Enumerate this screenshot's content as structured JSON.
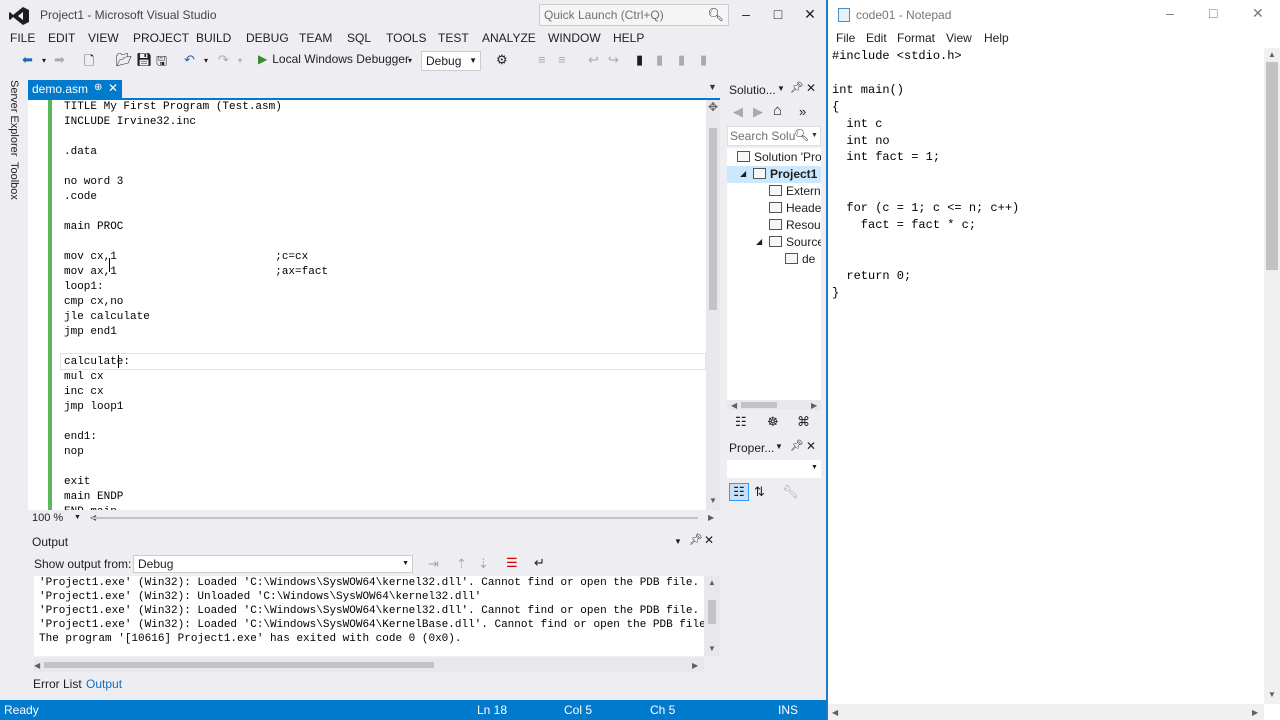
{
  "vs": {
    "title": "Project1 - Microsoft Visual Studio",
    "quick_launch_placeholder": "Quick Launch (Ctrl+Q)",
    "menu": [
      "FILE",
      "EDIT",
      "VIEW",
      "PROJECT",
      "BUILD",
      "DEBUG",
      "TEAM",
      "SQL",
      "TOOLS",
      "TEST",
      "ANALYZE",
      "WINDOW",
      "HELP"
    ],
    "toolbar": {
      "debugger_label": "Local Windows Debugger",
      "config": "Debug"
    },
    "side_tabs": [
      "Server Explorer",
      "Toolbox"
    ],
    "doc_tab": "demo.asm",
    "code_lines": [
      "TITLE My First Program (Test.asm)",
      "INCLUDE Irvine32.inc",
      "",
      ".data",
      "",
      "no word 3",
      ".code",
      "",
      "main PROC",
      "",
      "mov cx,1                        ;c=cx",
      "mov ax,1                        ;ax=fact",
      "loop1:",
      "cmp cx,no",
      "jle calculate",
      "jmp end1",
      "",
      "calculate:",
      "mul cx",
      "inc cx",
      "jmp loop1",
      "",
      "end1:",
      "nop",
      "",
      "exit",
      "main ENDP",
      "END main"
    ],
    "zoom": "100 %",
    "solution_explorer": {
      "title": "Solutio...",
      "search_placeholder": "Search Solu",
      "items": [
        {
          "label": "Solution 'Pro",
          "indent": 0,
          "expander": ""
        },
        {
          "label": "Project1",
          "indent": 1,
          "expander": "◢"
        },
        {
          "label": "Extern",
          "indent": 2,
          "expander": ""
        },
        {
          "label": "Heade",
          "indent": 2,
          "expander": ""
        },
        {
          "label": "Resou",
          "indent": 2,
          "expander": ""
        },
        {
          "label": "Source",
          "indent": 2,
          "expander": "◢"
        },
        {
          "label": "de",
          "indent": 3,
          "expander": ""
        }
      ]
    },
    "properties_title": "Proper...",
    "output": {
      "title": "Output",
      "show_from_label": "Show output from:",
      "source": "Debug",
      "lines": [
        "'Project1.exe' (Win32): Loaded 'C:\\Windows\\SysWOW64\\kernel32.dll'. Cannot find or open the PDB file.",
        "'Project1.exe' (Win32): Unloaded 'C:\\Windows\\SysWOW64\\kernel32.dll'",
        "'Project1.exe' (Win32): Loaded 'C:\\Windows\\SysWOW64\\kernel32.dll'. Cannot find or open the PDB file.",
        "'Project1.exe' (Win32): Loaded 'C:\\Windows\\SysWOW64\\KernelBase.dll'. Cannot find or open the PDB file",
        "The program '[10616] Project1.exe' has exited with code 0 (0x0)."
      ]
    },
    "bottom_tabs": [
      "Error List",
      "Output"
    ],
    "status": {
      "ready": "Ready",
      "ln": "Ln 18",
      "col": "Col 5",
      "ch": "Ch 5",
      "mode": "INS"
    }
  },
  "notepad": {
    "title": "code01 - Notepad",
    "menu": [
      "File",
      "Edit",
      "Format",
      "View",
      "Help"
    ],
    "lines": [
      "#include <stdio.h>",
      "",
      "int main()",
      "{",
      "  int c",
      "  int no",
      "  int fact = 1;",
      "",
      "",
      "  for (c = 1; c <= n; c++)",
      "    fact = fact * c;",
      "",
      "",
      "  return 0;",
      "}"
    ]
  },
  "colors": {
    "accent": "#007acc",
    "margin_green": "#5cb85c",
    "play_green": "#388a34",
    "selection": "#cce8ff"
  }
}
